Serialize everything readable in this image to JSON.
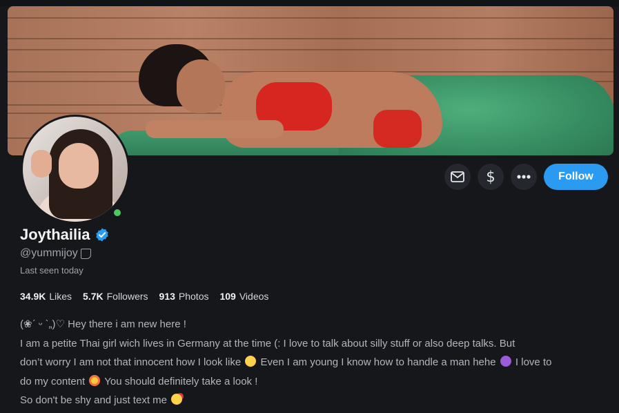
{
  "profile": {
    "name": "Joythailia",
    "handle": "@yummijoy",
    "last_seen": "Last seen today"
  },
  "actions": {
    "message_icon": "envelope-icon",
    "tip_symbol": "$",
    "more_icon": "more-dots-icon",
    "follow_label": "Follow"
  },
  "stats": [
    {
      "value": "34.9K",
      "label": "Likes"
    },
    {
      "value": "5.7K",
      "label": "Followers"
    },
    {
      "value": "913",
      "label": "Photos"
    },
    {
      "value": "109",
      "label": "Videos"
    }
  ],
  "bio": {
    "line1": "(❀ˊ ᵕ ˋ„)♡ Hey there i am new here !",
    "line2": "I am a petite Thai girl wich lives  in Germany at the time (: I love to talk  about silly stuff or also deep talks. But",
    "line3a": "don’t worry I am not that innocent how I look like",
    "line3b": "Even I am young I know how to handle a man hehe",
    "line3c": "I love to",
    "line4a": "do my content",
    "line4b": "You should definitely take a look !",
    "line5": "So don't be shy and just text me"
  },
  "colors": {
    "accent": "#2a9bf0",
    "background": "#16171b",
    "online": "#4cc85c"
  }
}
